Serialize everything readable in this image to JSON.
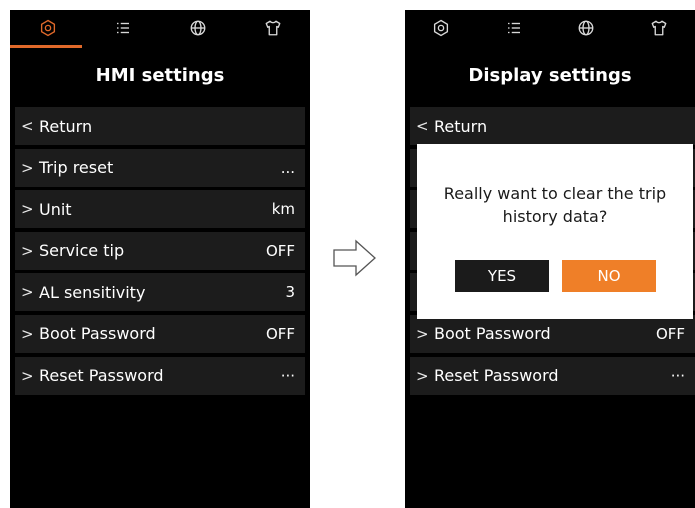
{
  "colors": {
    "accent": "#e0692a",
    "button_no": "#ef7f28",
    "row_bg": "#1c1c1c",
    "screen_bg": "#000000"
  },
  "tabs": [
    "settings-icon",
    "list-icon",
    "globe-icon",
    "shirt-icon"
  ],
  "left_screen": {
    "title": "HMI settings",
    "rows": [
      {
        "chevron": "<",
        "label": "Return",
        "value": ""
      },
      {
        "chevron": ">",
        "label": "Trip reset",
        "value": "..."
      },
      {
        "chevron": ">",
        "label": "Unit",
        "value": "km"
      },
      {
        "chevron": ">",
        "label": "Service tip",
        "value": "OFF"
      },
      {
        "chevron": ">",
        "label": "AL sensitivity",
        "value": "3"
      },
      {
        "chevron": ">",
        "label": "Boot Password",
        "value": "OFF"
      },
      {
        "chevron": ">",
        "label": "Reset Password",
        "value": "···"
      }
    ]
  },
  "right_screen": {
    "title": "Display settings",
    "rows": [
      {
        "chevron": "<",
        "label": "Return",
        "value": ""
      },
      {
        "chevron": ">",
        "label": "",
        "value": ""
      },
      {
        "chevron": ">",
        "label": "",
        "value": ""
      },
      {
        "chevron": ">",
        "label": "",
        "value": ""
      },
      {
        "chevron": ">",
        "label": "",
        "value": ""
      },
      {
        "chevron": ">",
        "label": "Boot Password",
        "value": "OFF"
      },
      {
        "chevron": ">",
        "label": "Reset Password",
        "value": "···"
      }
    ],
    "dialog": {
      "message": "Really want to clear the trip history data?",
      "yes_label": "YES",
      "no_label": "NO"
    }
  }
}
